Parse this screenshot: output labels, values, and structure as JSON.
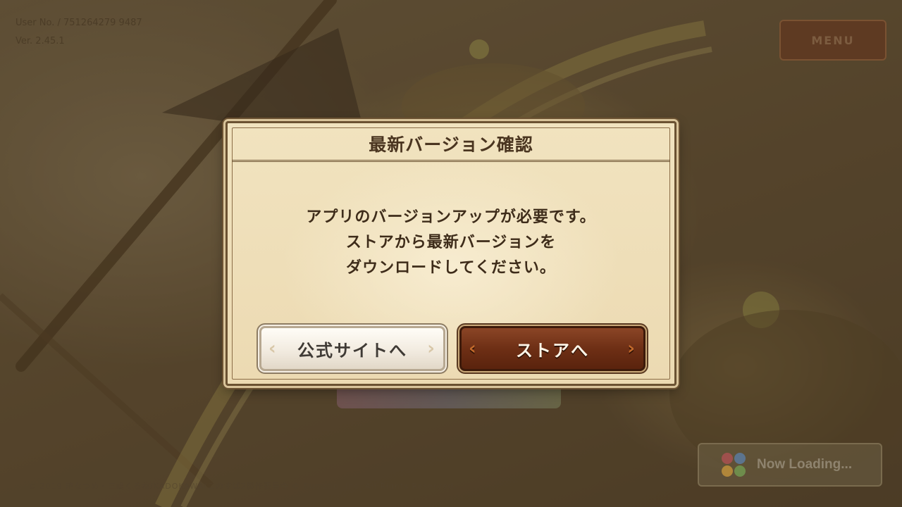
{
  "background": {
    "info_line1": "User No. / 751264279 9487",
    "info_line2": "Ver. 2.45.1",
    "menu_label": "MENU",
    "footer": "© 2019 暁なつめ・三嶋くろね/KADOKAWA/このすば2製作委員会 © Sumzap, Inc. All Rights Reserved."
  },
  "dialog": {
    "title": "最新バージョン確認",
    "message_line1": "アプリのバージョンアップが必要です。",
    "message_line2": "ストアから最新バージョンを",
    "message_line3": "ダウンロードしてください。",
    "official_site_button": "公式サイトへ",
    "store_button": "ストアへ"
  },
  "loading": {
    "text": "Now Loading..."
  },
  "colors": {
    "dialog_parchment": "#f1e3bf",
    "dialog_border": "#6b5232",
    "store_button": "#6e2f15",
    "site_button": "#f2ebe0"
  }
}
